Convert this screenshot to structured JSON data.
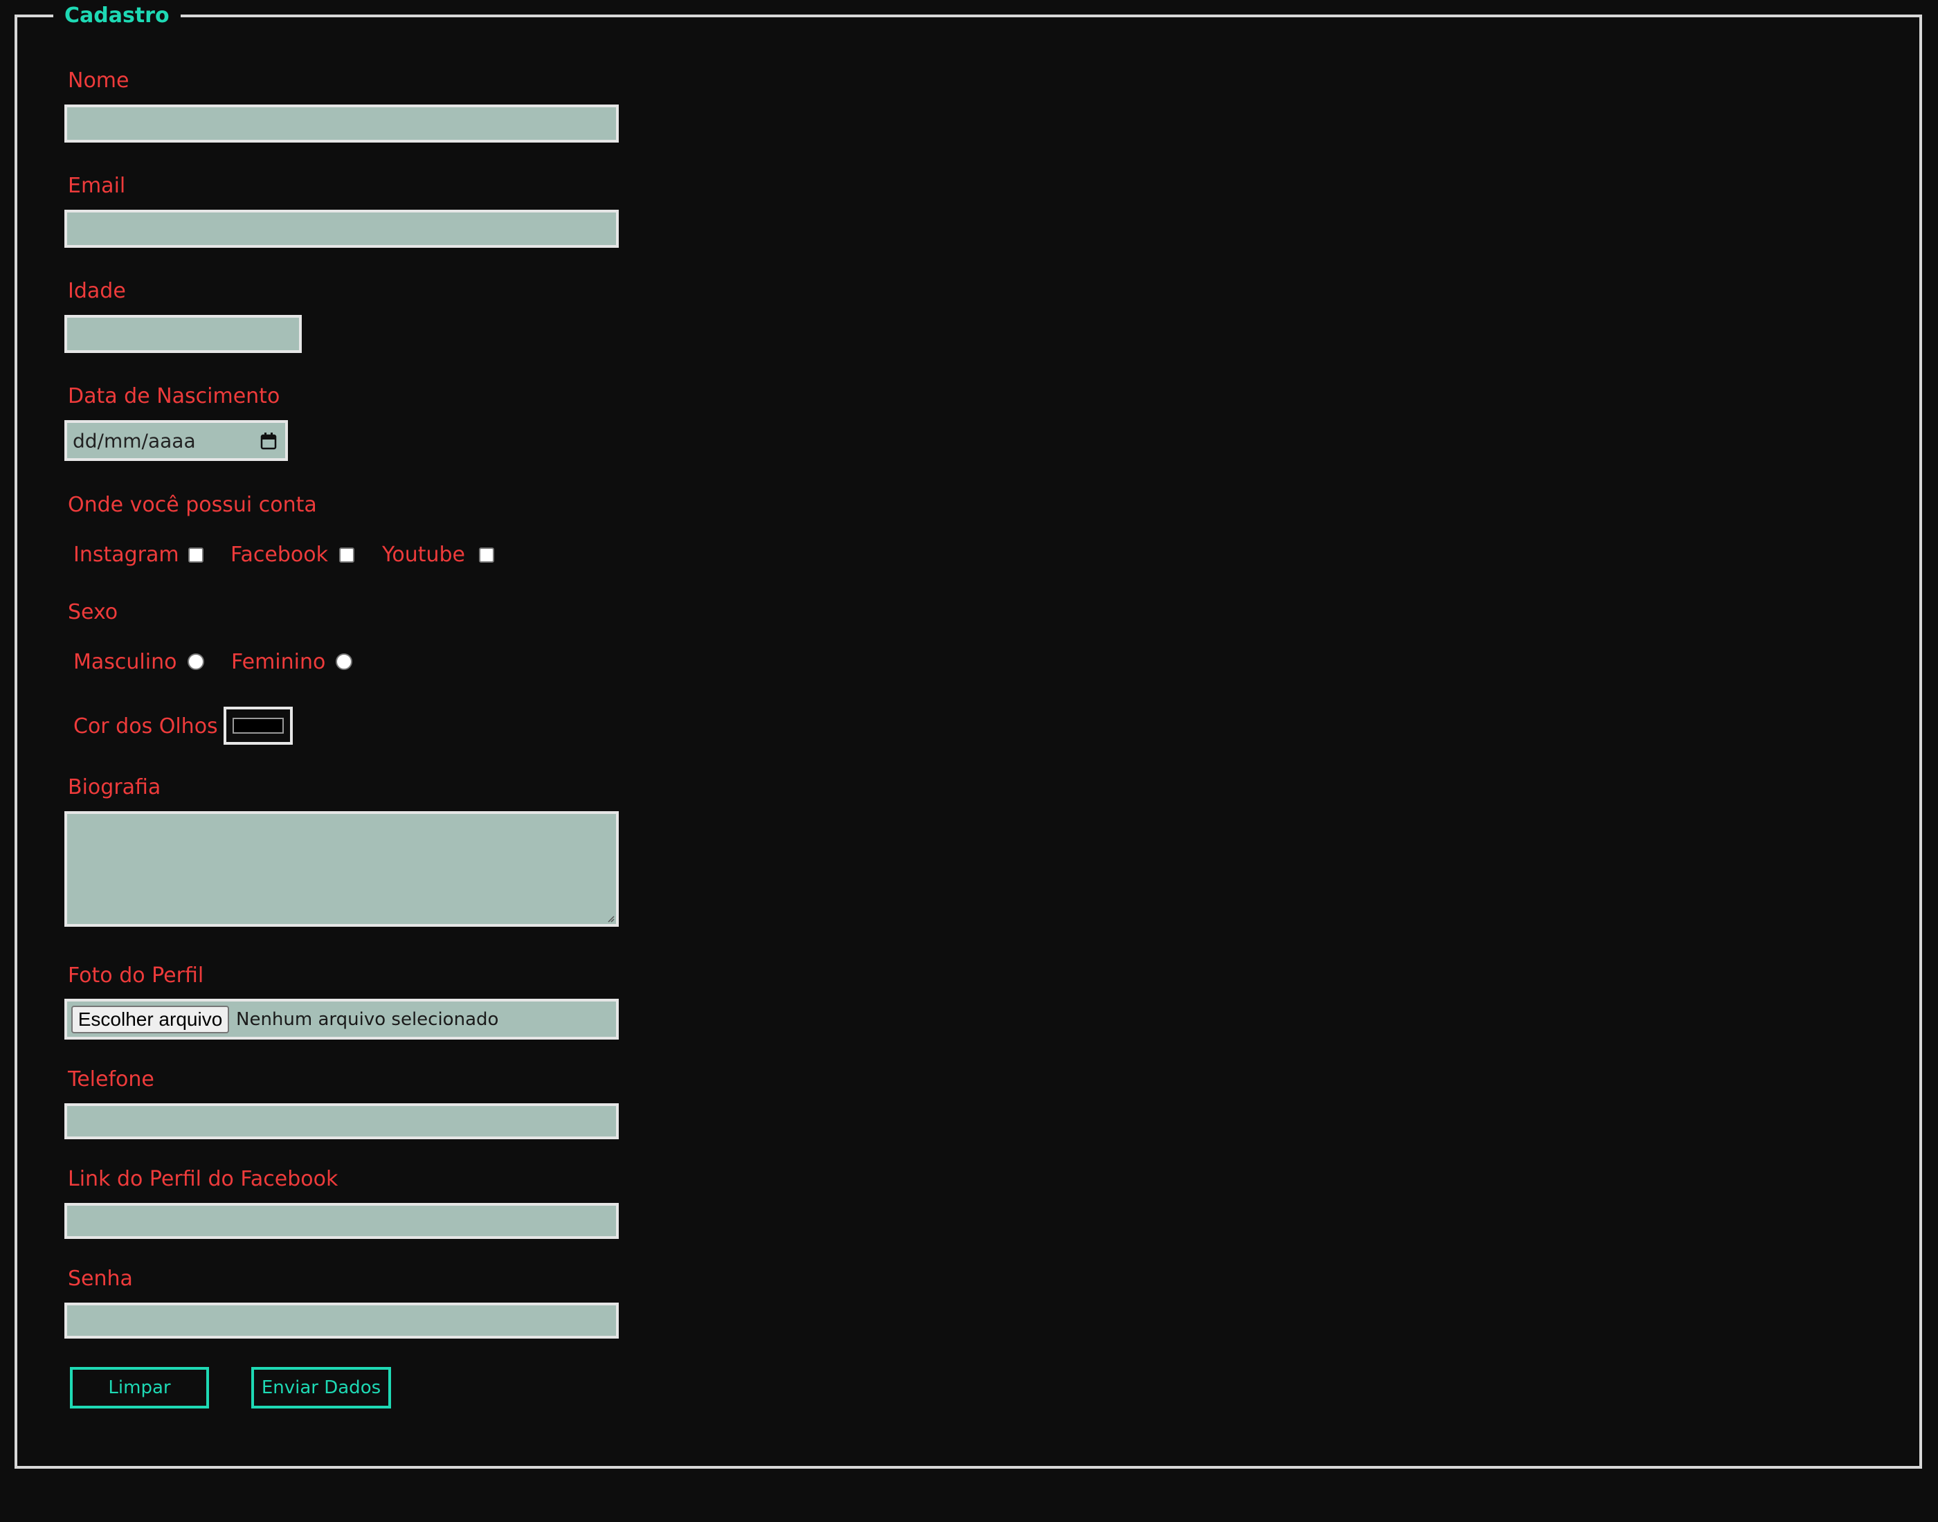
{
  "form": {
    "legend": "Cadastro",
    "nome_label": "Nome",
    "email_label": "Email",
    "idade_label": "Idade",
    "nascimento_label": "Data de Nascimento",
    "nascimento_placeholder": "dd/mm/aaaa",
    "contas_label": "Onde você possui conta",
    "contas_options": [
      "Instagram",
      "Facebook",
      "Youtube"
    ],
    "sexo_label": "Sexo",
    "sexo_options": [
      "Masculino",
      "Feminino"
    ],
    "olhos_label": "Cor dos Olhos",
    "olhos_value": "#000000",
    "biografia_label": "Biografia",
    "foto_label": "Foto do Perfil",
    "foto_button": "Escolher arquivo",
    "foto_status": "Nenhum arquivo selecionado",
    "telefone_label": "Telefone",
    "facebook_link_label": "Link do Perfil do Facebook",
    "senha_label": "Senha",
    "limpar_button": "Limpar",
    "enviar_button": "Enviar Dados"
  },
  "colors": {
    "background": "#0d0d0d",
    "label": "#ee3b3b",
    "accent": "#1ed9b4",
    "field": "#a6bfb7",
    "border": "#e6e6e6"
  },
  "icons": {
    "date": "calendar-icon"
  }
}
